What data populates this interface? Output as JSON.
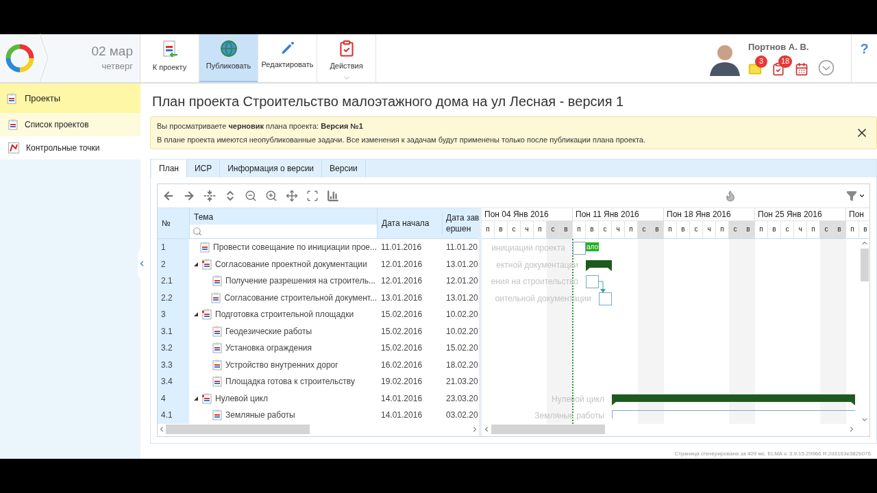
{
  "header": {
    "date": "02 мар",
    "weekday": "четверг",
    "toolbar": [
      {
        "label": "К проекту",
        "hovered": false,
        "dropdown": false
      },
      {
        "label": "Публиковать",
        "hovered": true,
        "dropdown": false
      },
      {
        "label": "Редактировать",
        "hovered": false,
        "dropdown": false
      },
      {
        "label": "Действия",
        "hovered": false,
        "dropdown": true
      }
    ],
    "user": {
      "name": "Портнов А. В.",
      "messages_badge": "3",
      "tasks_badge": "18"
    },
    "help": "?"
  },
  "sidebar": {
    "heading": "Проекты",
    "items": [
      {
        "label": "Список проектов",
        "selected": true
      },
      {
        "label": "Контрольные точки",
        "selected": false
      }
    ]
  },
  "page_title": "План проекта Строительство малоэтажного дома на ул Лесная - версия 1",
  "notice": {
    "text": "Вы просматриваете **черновик** плана проекта: **Версия №1**",
    "detail": "В плане проекта имеются неопубликованные задачи. Все изменения к задачам будут применены только после публикации плана проекта."
  },
  "tabs": [
    {
      "label": "План",
      "selected": true
    },
    {
      "label": "ИСР",
      "selected": false
    },
    {
      "label": "Информация о версии",
      "selected": false
    },
    {
      "label": "Версии",
      "selected": false
    }
  ],
  "grid": {
    "columns": [
      "№",
      "Тема",
      "Дата начала",
      "Дата завершен"
    ],
    "rows": [
      {
        "no": "1",
        "topic": "Провести совещание по инициации прое...",
        "start": "11.01.2016",
        "end": "11.01.20"
      },
      {
        "no": "2",
        "topic": "Согласование проектной документации",
        "start": "12.01.2016",
        "end": "13.01.20",
        "expanded": true,
        "children": [
          {
            "no": "2.1",
            "topic": "Получение разрешения на строитель...",
            "start": "12.01.2016",
            "end": "12.01.20"
          },
          {
            "no": "2.2",
            "topic": "Согласование строительной документ...",
            "start": "13.01.2016",
            "end": "13.01.20"
          }
        ]
      },
      {
        "no": "3",
        "topic": "Подготовка строительной площадки",
        "start": "15.02.2016",
        "end": "10.02.20",
        "expanded": true,
        "children": [
          {
            "no": "3.1",
            "topic": "Геодезические работы",
            "start": "15.02.2016",
            "end": "10.02.20"
          },
          {
            "no": "3.2",
            "topic": "Установка ограждения",
            "start": "15.02.2016",
            "end": "15.02.20"
          },
          {
            "no": "3.3",
            "topic": "Устройство внутренних дорог",
            "start": "16.02.2016",
            "end": "18.02.20"
          },
          {
            "no": "3.4",
            "topic": "Площадка готова к строительству",
            "start": "19.02.2016",
            "end": "21.03.20"
          }
        ]
      },
      {
        "no": "4",
        "topic": "Нулевой цикл",
        "start": "14.01.2016",
        "end": "23.03.20",
        "expanded": true,
        "children": [
          {
            "no": "4.1",
            "topic": "Земляные работы",
            "start": "14.01.2016",
            "end": "03.02.20"
          }
        ]
      }
    ]
  },
  "gantt": {
    "weeks": [
      "Пон 04 Янв 2016",
      "Пон 11 Янв 2016",
      "Пон 18 Янв 2016",
      "Пон 25 Янв 2016",
      "Пон"
    ],
    "days": [
      {
        "label": "п",
        "weekend": false
      },
      {
        "label": "в",
        "weekend": false
      },
      {
        "label": "с",
        "weekend": false
      },
      {
        "label": "ч",
        "weekend": false
      },
      {
        "label": "п",
        "weekend": false
      },
      {
        "label": "с",
        "weekend": true
      },
      {
        "label": "в",
        "weekend": true
      },
      {
        "label": "п",
        "weekend": false
      },
      {
        "label": "в",
        "weekend": false
      },
      {
        "label": "с",
        "weekend": false
      },
      {
        "label": "ч",
        "weekend": false
      },
      {
        "label": "п",
        "weekend": false
      },
      {
        "label": "с",
        "weekend": true
      },
      {
        "label": "в",
        "weekend": true
      },
      {
        "label": "п",
        "weekend": false
      },
      {
        "label": "в",
        "weekend": false
      },
      {
        "label": "с",
        "weekend": false
      },
      {
        "label": "ч",
        "weekend": false
      },
      {
        "label": "п",
        "weekend": false
      },
      {
        "label": "с",
        "weekend": true
      },
      {
        "label": "в",
        "weekend": true
      },
      {
        "label": "п",
        "weekend": false
      },
      {
        "label": "в",
        "weekend": false
      },
      {
        "label": "с",
        "weekend": false
      },
      {
        "label": "ч",
        "weekend": false
      },
      {
        "label": "п",
        "weekend": false
      },
      {
        "label": "с",
        "weekend": true
      },
      {
        "label": "в",
        "weekend": true
      },
      {
        "label": "п",
        "weekend": false
      },
      {
        "label": "в",
        "weekend": false
      }
    ],
    "bars": [
      {
        "label": "инициации проекта",
        "kind": "task",
        "tag": "ало"
      },
      {
        "label": "ектной документации",
        "kind": "summary"
      },
      {
        "label": "ения на строительство",
        "kind": "task"
      },
      {
        "label": "оительной документации",
        "kind": "task"
      },
      {
        "label": "Нулевой цикл",
        "kind": "summary"
      },
      {
        "label": "Земляные работы",
        "kind": "line"
      }
    ]
  },
  "footer": "Страница сгенерирована за 409 мс. ELMA v. 3.9.15.29966 R.2d3163e382b076"
}
